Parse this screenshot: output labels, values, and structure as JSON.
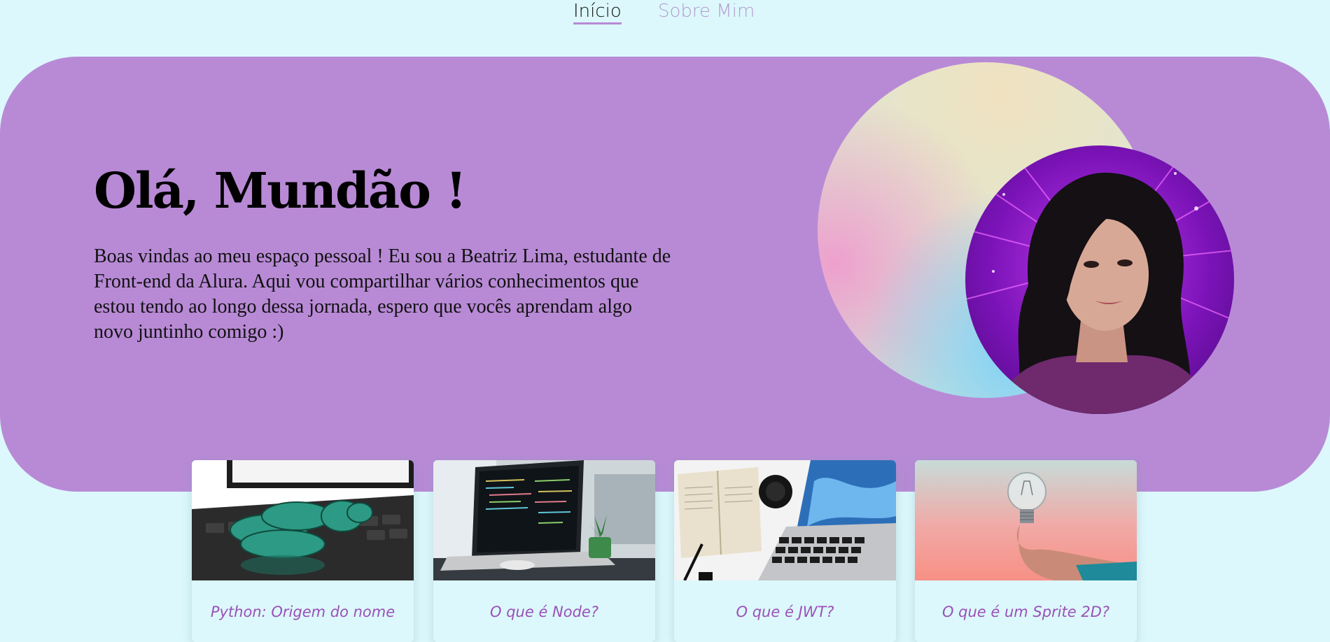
{
  "nav": {
    "items": [
      {
        "label": "Início",
        "active": true
      },
      {
        "label": "Sobre Mim",
        "active": false
      }
    ]
  },
  "hero": {
    "title": "Olá, Mundão !",
    "description": "Boas vindas ao meu espaço pessoal ! Eu sou a Beatriz Lima, estudante de Front-end da Alura. Aqui vou compartilhar vários conhecimentos que estou tendo ao longo dessa jornada, espero que vocês aprendam algo novo juntinho comigo :)"
  },
  "cards": [
    {
      "title": "Python: Origem do nome",
      "image": "snake-on-laptop"
    },
    {
      "title": "O que é Node?",
      "image": "laptop-with-code"
    },
    {
      "title": "O que é JWT?",
      "image": "laptop-and-book"
    },
    {
      "title": "O que é um Sprite 2D?",
      "image": "lightbulb-in-hand"
    }
  ],
  "colors": {
    "page_background": "#dcf8fc",
    "hero_background": "#b88ad6",
    "accent": "#b88ad6",
    "card_title": "#9b51b7",
    "nav_inactive": "#b49bd0"
  }
}
